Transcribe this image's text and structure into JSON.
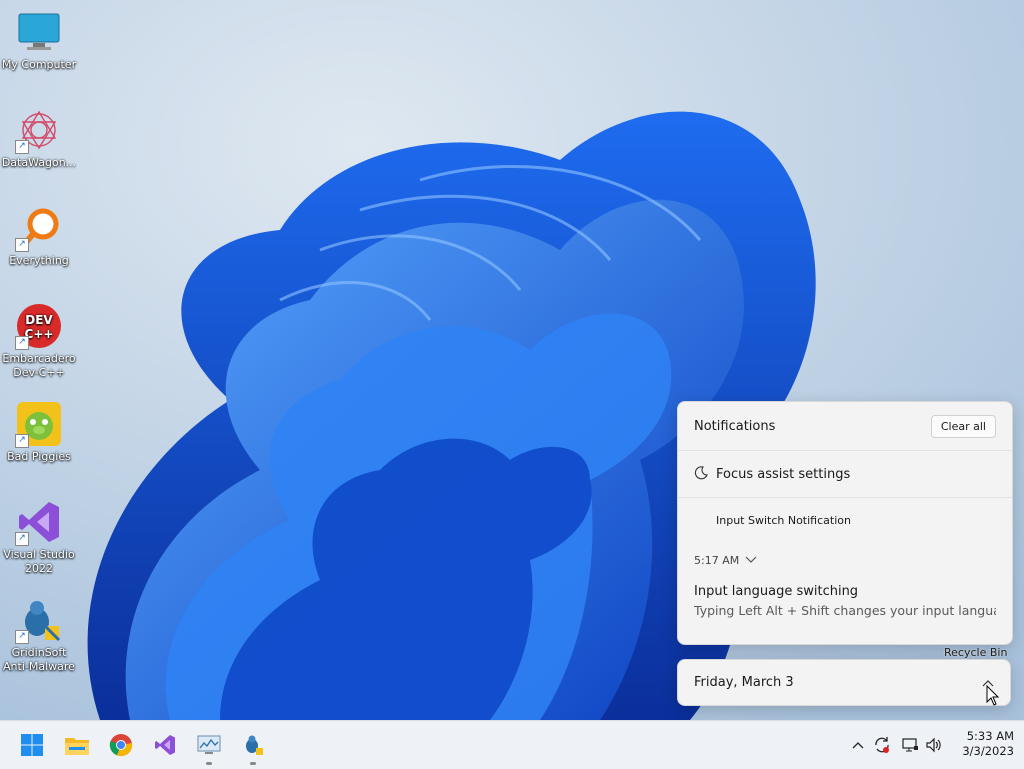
{
  "desktop": {
    "icons": [
      {
        "label": "My Computer",
        "icon": "monitor-icon"
      },
      {
        "label": "DataWagon...",
        "icon": "datawagon-icon"
      },
      {
        "label": "Everything",
        "icon": "magnifier-icon"
      },
      {
        "label": "Embarcadero Dev-C++",
        "icon": "devcpp-icon",
        "badge": "DEV C++"
      },
      {
        "label": "Bad Piggies",
        "icon": "bad-piggies-icon"
      },
      {
        "label": "Visual Studio 2022",
        "icon": "visual-studio-icon"
      },
      {
        "label": "GridinSoft Anti-Malware",
        "icon": "gridinsoft-icon"
      }
    ],
    "recycle_bin_label": "Recycle Bin"
  },
  "notifications": {
    "title": "Notifications",
    "clear_all": "Clear all",
    "focus_assist": "Focus assist settings",
    "items": [
      {
        "app": "Input Switch Notification",
        "time": "5:17 AM",
        "title": "Input language switching",
        "body": "Typing Left Alt + Shift changes your input langua"
      }
    ]
  },
  "calendar": {
    "date": "Friday, March 3"
  },
  "taskbar": {
    "apps": [
      "start-icon",
      "file-explorer-icon",
      "chrome-icon",
      "visual-studio-icon",
      "monitor-app-icon",
      "gridinsoft-icon"
    ],
    "tray": [
      "chevron-up-icon",
      "sync-icon",
      "network-icon",
      "volume-icon"
    ],
    "time": "5:33 AM",
    "date": "3/3/2023"
  },
  "colors": {
    "accent": "#0b63d6",
    "wallpaper_bg": "#c3d3e2",
    "panel_bg": "#f3f3f3"
  }
}
